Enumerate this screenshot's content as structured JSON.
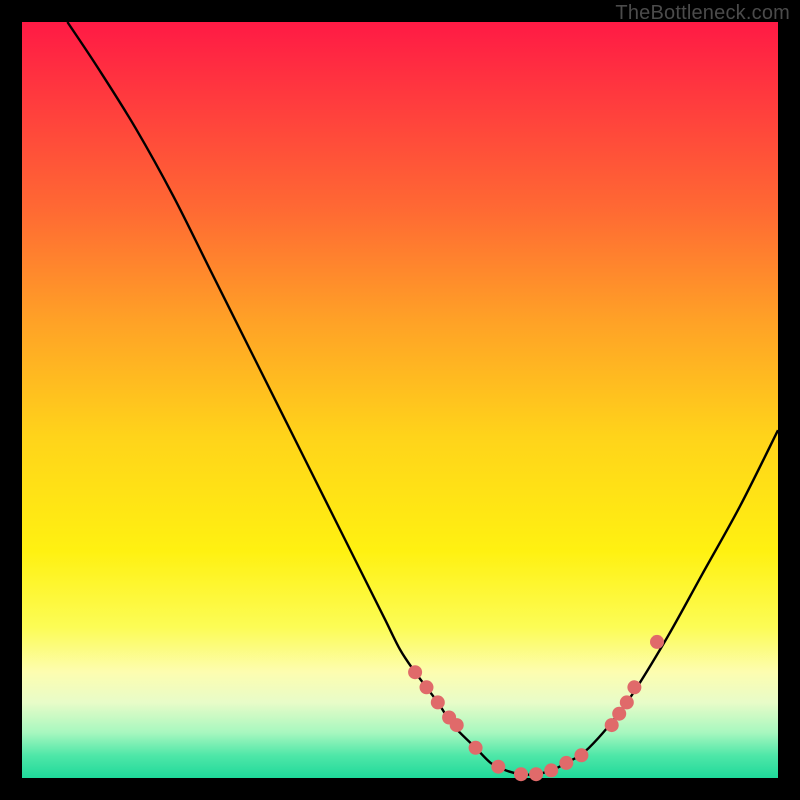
{
  "watermark": "TheBottleneck.com",
  "colors": {
    "curve_stroke": "#000000",
    "dot_fill": "#e06a6a",
    "dot_stroke": "#c44f4f",
    "gradient_stops": [
      "#ff1a45",
      "#ff6a33",
      "#ffd41a",
      "#fcfc55",
      "#a7f7bf",
      "#1fd99a"
    ]
  },
  "chart_data": {
    "type": "line",
    "title": "",
    "xlabel": "",
    "ylabel": "",
    "xlim": [
      0,
      100
    ],
    "ylim": [
      0,
      100
    ],
    "grid": false,
    "series": [
      {
        "name": "bottleneck-curve",
        "x": [
          6,
          10,
          15,
          20,
          25,
          30,
          35,
          40,
          45,
          48,
          50,
          52,
          55,
          57,
          60,
          62,
          64,
          66,
          68,
          70,
          72,
          75,
          80,
          85,
          90,
          95,
          100
        ],
        "y": [
          100,
          94,
          86,
          77,
          67,
          57,
          47,
          37,
          27,
          21,
          17,
          14,
          10,
          7,
          4,
          2,
          1,
          0.5,
          0.5,
          1,
          2,
          4,
          10,
          18,
          27,
          36,
          46
        ]
      }
    ],
    "highlight_points": {
      "name": "curve-dots",
      "x": [
        52,
        53.5,
        55,
        56.5,
        57.5,
        60,
        63,
        66,
        68,
        70,
        72,
        74,
        78,
        79,
        80,
        81,
        84
      ],
      "y": [
        14,
        12,
        10,
        8,
        7,
        4,
        1.5,
        0.5,
        0.5,
        1,
        2,
        3,
        7,
        8.5,
        10,
        12,
        18
      ]
    }
  }
}
